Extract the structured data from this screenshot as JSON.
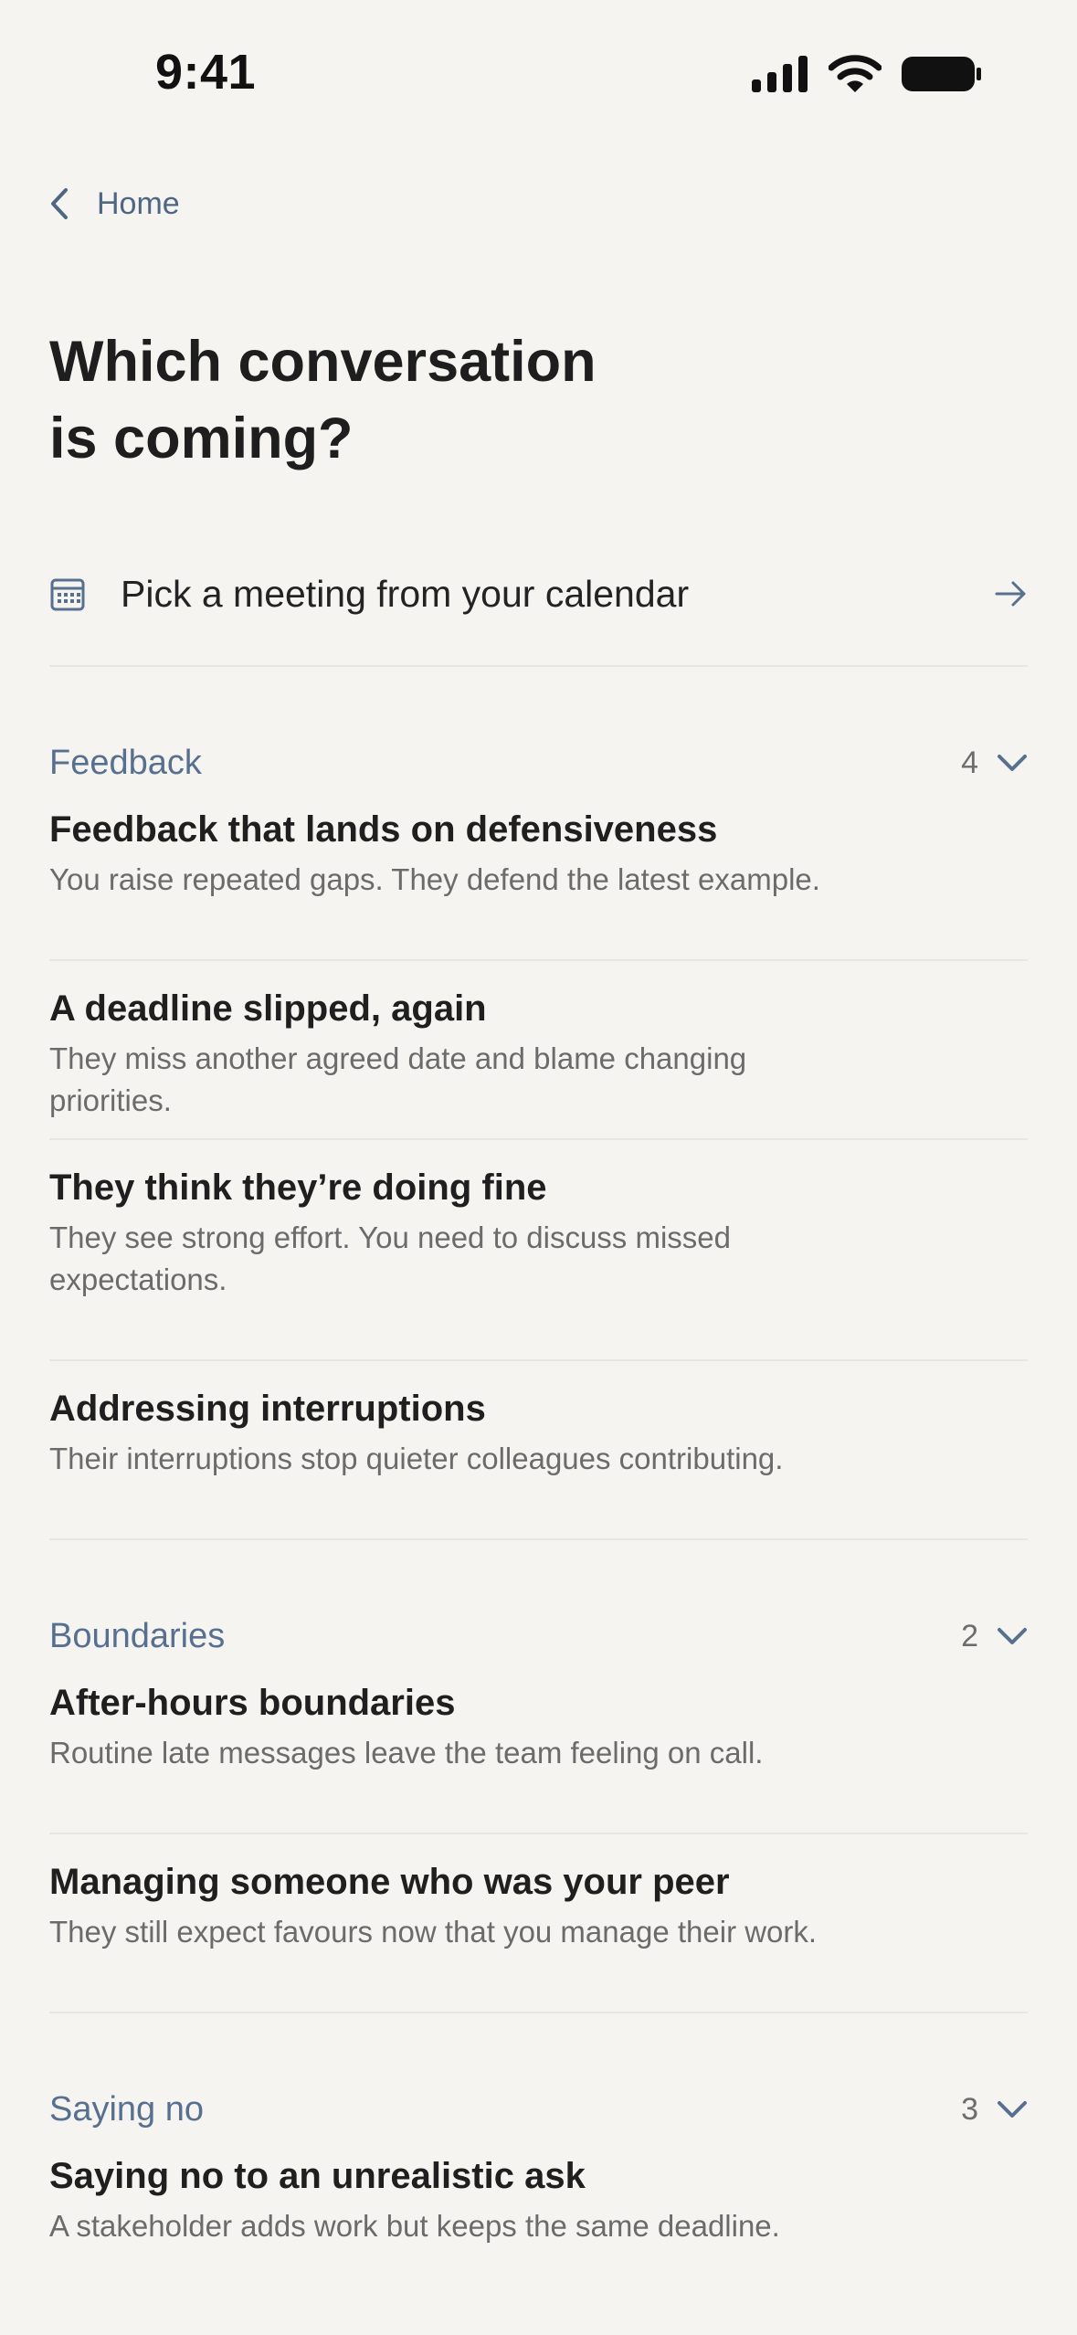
{
  "status": {
    "time": "9:41"
  },
  "nav": {
    "back_label": "Home"
  },
  "title": {
    "line1": "Which conversation",
    "line2": "is coming?"
  },
  "calendar": {
    "label": "Pick a meeting from your calendar"
  },
  "sections": [
    {
      "title": "Feedback",
      "count": "4",
      "items": [
        {
          "title": "Feedback that lands on defensiveness",
          "desc": "You raise repeated gaps. They defend the latest example."
        },
        {
          "title": "A deadline slipped, again",
          "desc": "They miss another agreed date and blame changing priorities."
        },
        {
          "title": "They think they’re doing fine",
          "desc": "They see strong effort. You need to discuss missed expectations."
        },
        {
          "title": "Addressing interruptions",
          "desc": "Their interruptions stop quieter colleagues contributing."
        }
      ]
    },
    {
      "title": "Boundaries",
      "count": "2",
      "items": [
        {
          "title": "After-hours boundaries",
          "desc": "Routine late messages leave the team feeling on call."
        },
        {
          "title": "Managing someone who was your peer",
          "desc": "They still expect favours now that you manage their work."
        }
      ]
    },
    {
      "title": "Saying no",
      "count": "3",
      "items": [
        {
          "title": "Saying no to an unrealistic ask",
          "desc": "A stakeholder adds work but keeps the same deadline."
        }
      ]
    }
  ],
  "colors": {
    "accent": "#577090",
    "background": "#f5f4f1",
    "divider": "#e9e7e3"
  },
  "icons": [
    "signal-icon",
    "wifi-icon",
    "battery-icon",
    "chevron-left-icon",
    "calendar-icon",
    "arrow-right-icon",
    "chevron-down-icon"
  ]
}
